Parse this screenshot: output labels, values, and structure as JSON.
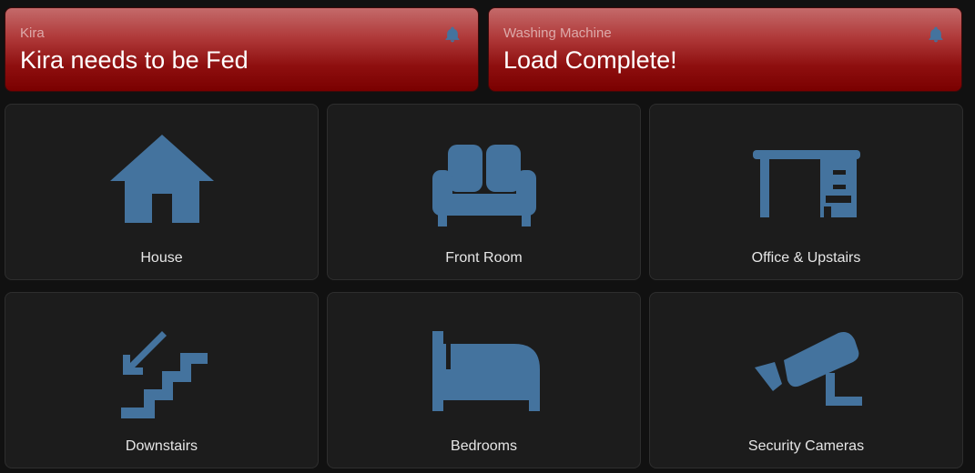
{
  "alerts": [
    {
      "label": "Kira",
      "message": "Kira needs to be Fed",
      "icon": "bell-icon"
    },
    {
      "label": "Washing Machine",
      "message": "Load Complete!",
      "icon": "bell-icon"
    }
  ],
  "tiles": [
    {
      "label": "House",
      "icon": "house-icon"
    },
    {
      "label": "Front Room",
      "icon": "sofa-icon"
    },
    {
      "label": "Office & Upstairs",
      "icon": "desk-icon"
    },
    {
      "label": "Downstairs",
      "icon": "stairs-down-icon"
    },
    {
      "label": "Bedrooms",
      "icon": "bed-icon"
    },
    {
      "label": "Security Cameras",
      "icon": "cctv-icon"
    }
  ],
  "colors": {
    "icon": "#44739e",
    "alert_top": "#c46a6a",
    "alert_bottom": "#7a0000",
    "tile_bg": "#1c1c1c",
    "page_bg": "#111111"
  }
}
